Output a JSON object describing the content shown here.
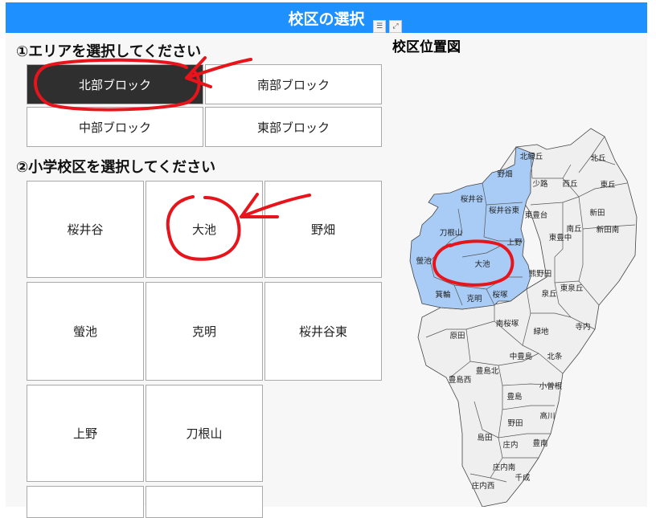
{
  "title": "校区の選択",
  "step1": {
    "heading": "①エリアを選択してください",
    "areas": [
      "北部ブロック",
      "南部ブロック",
      "中部ブロック",
      "東部ブロック"
    ],
    "selected": "北部ブロック"
  },
  "step2": {
    "heading": "②小学校区を選択してください",
    "schools": [
      "桜井谷",
      "大池",
      "野畑",
      "螢池",
      "克明",
      "桜井谷東",
      "上野",
      "刀根山"
    ]
  },
  "map": {
    "title": "校区位置図",
    "highlight_color": "#a9ccf6",
    "district_labels": [
      "北緑丘",
      "北丘",
      "野畑",
      "少路",
      "西丘",
      "東丘",
      "桜井谷",
      "桜井谷東",
      "東豊台",
      "新田",
      "南丘",
      "刀根山",
      "東豊中",
      "新田南",
      "上野",
      "螢池",
      "大池",
      "熊野田",
      "箕輪",
      "克明",
      "桜塚",
      "東泉丘",
      "泉丘",
      "原田",
      "南桜塚",
      "緑地",
      "寺内",
      "中豊島",
      "北条",
      "豊島北",
      "豊島西",
      "小曽根",
      "豊島",
      "高川",
      "野田",
      "島田",
      "庄内",
      "豊南",
      "庄内南",
      "千成",
      "庄内西"
    ]
  },
  "icons": {
    "filter": "filter-icon",
    "expand": "expand-icon"
  },
  "annotation_color": "#e8141b"
}
